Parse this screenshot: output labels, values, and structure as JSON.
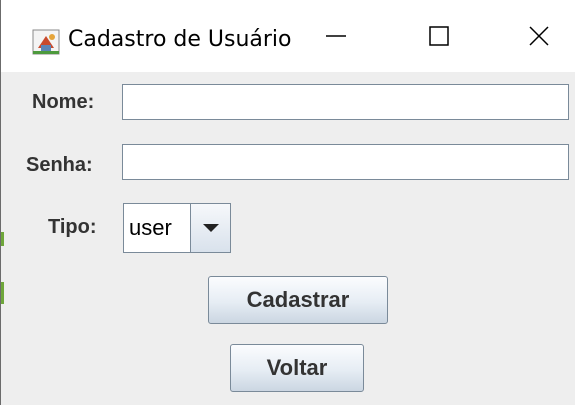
{
  "window": {
    "title": "Cadastro de Usuário",
    "icon": "java-cup-icon",
    "controls": {
      "minimize": "minimize-icon",
      "maximize": "maximize-icon",
      "close": "close-icon"
    }
  },
  "form": {
    "nome_label": "Nome:",
    "nome_value": "",
    "senha_label": "Senha:",
    "senha_value": "",
    "tipo_label": "Tipo:",
    "tipo_selected": "user",
    "cadastrar_label": "Cadastrar",
    "voltar_label": "Voltar"
  },
  "colors": {
    "background": "#eeeeee",
    "titlebar": "#ffffff",
    "border": "#7a8a99"
  }
}
